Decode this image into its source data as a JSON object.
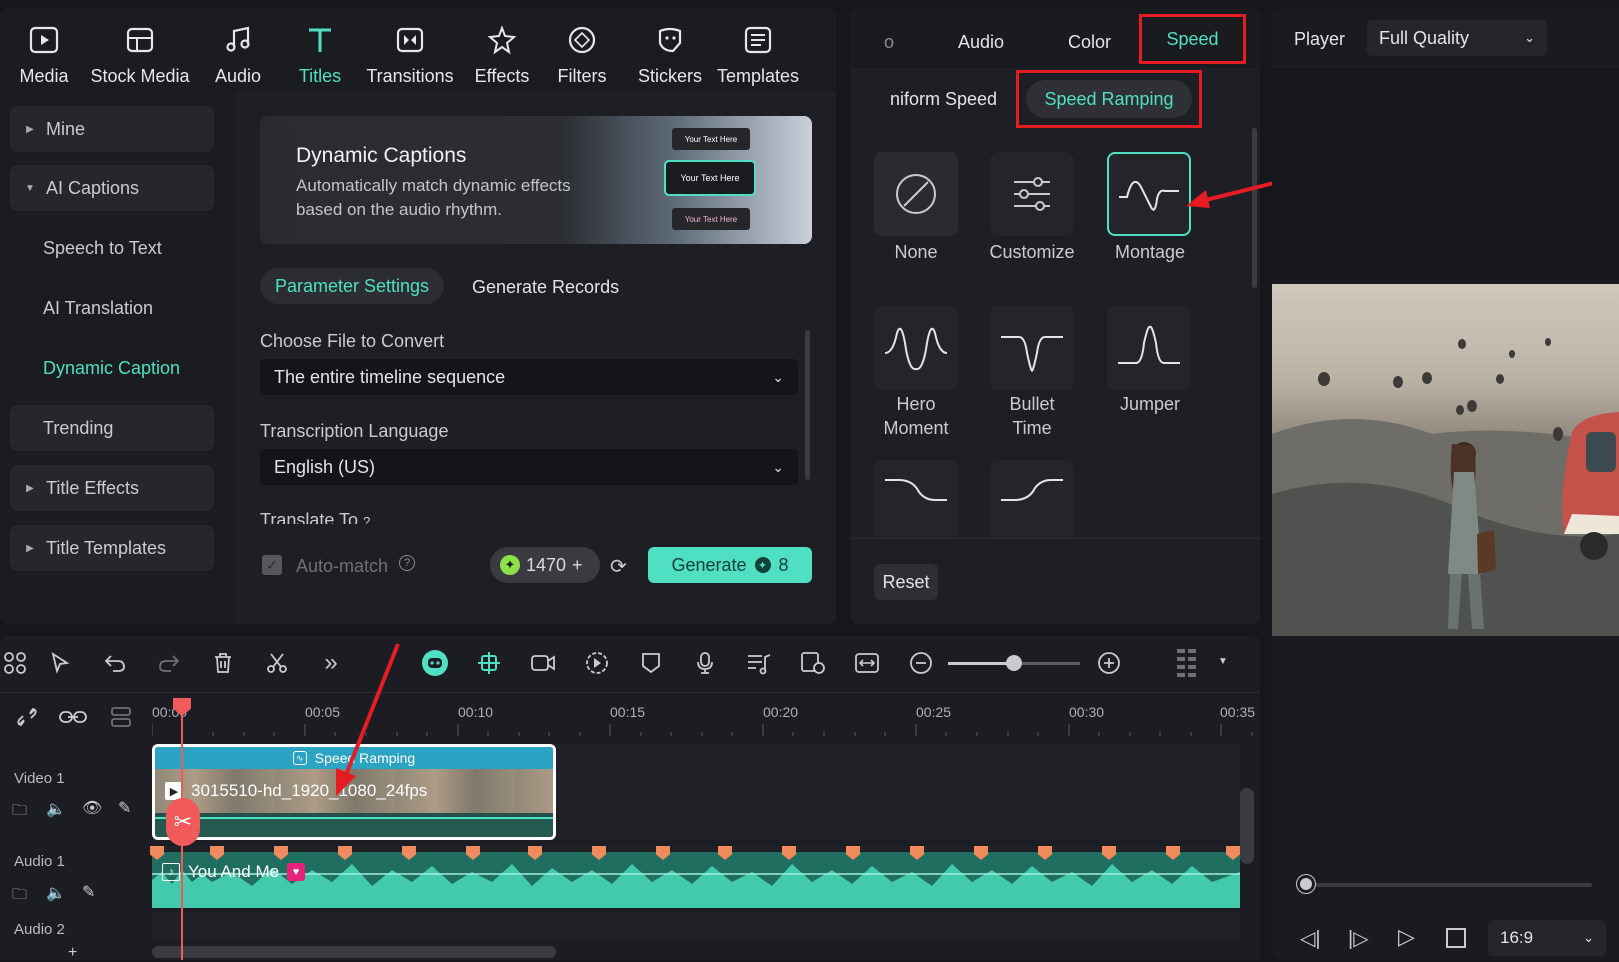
{
  "topnav": [
    {
      "label": "Media",
      "icon": "media-icon"
    },
    {
      "label": "Stock Media",
      "icon": "stock-media-icon"
    },
    {
      "label": "Audio",
      "icon": "music-note-icon"
    },
    {
      "label": "Titles",
      "icon": "titles-t-icon"
    },
    {
      "label": "Transitions",
      "icon": "transitions-icon"
    },
    {
      "label": "Effects",
      "icon": "effects-star-icon"
    },
    {
      "label": "Filters",
      "icon": "filters-icon"
    },
    {
      "label": "Stickers",
      "icon": "stickers-icon"
    },
    {
      "label": "Templates",
      "icon": "templates-icon"
    }
  ],
  "sidebar": {
    "items": [
      {
        "label": "Mine"
      },
      {
        "label": "AI Captions"
      },
      {
        "label": "Speech to Text"
      },
      {
        "label": "AI Translation"
      },
      {
        "label": "Dynamic Caption"
      },
      {
        "label": "Trending"
      },
      {
        "label": "Title Effects"
      },
      {
        "label": "Title Templates"
      }
    ]
  },
  "banner": {
    "title": "Dynamic Captions",
    "description": "Automatically match dynamic effects based on the audio rhythm.",
    "thumb_captions": [
      "Your Text Here",
      "Your Text Here",
      "Your Text Here"
    ]
  },
  "caption_tabs": [
    "Parameter Settings",
    "Generate Records"
  ],
  "form": {
    "file_label": "Choose File to Convert",
    "file_value": "The entire timeline sequence",
    "lang_label": "Transcription Language",
    "lang_value": "English (US)",
    "translate_label": "Translate To",
    "automatch_label": "Auto-match",
    "credits": "1470",
    "generate_label": "Generate",
    "generate_cost": "8"
  },
  "props": {
    "tabs": [
      "o",
      "Audio",
      "Color",
      "Speed"
    ],
    "subtabs": [
      "niform Speed",
      "Speed Ramping"
    ],
    "presets": [
      {
        "label": "None"
      },
      {
        "label": "Customize"
      },
      {
        "label": "Montage"
      },
      {
        "label": "Hero Moment"
      },
      {
        "label": "Bullet Time"
      },
      {
        "label": "Jumper"
      }
    ],
    "reset_label": "Reset"
  },
  "player": {
    "label": "Player",
    "quality": "Full Quality",
    "aspect": "16:9",
    "progress": 0.02
  },
  "timeline": {
    "ruler": [
      "00:00",
      "00:05",
      "00:10",
      "00:15",
      "00:20",
      "00:25",
      "00:30",
      "00:35"
    ],
    "tracks": [
      "Video 1",
      "Audio 1",
      "Audio 2"
    ],
    "video_clip": {
      "badge": "Speed Ramping",
      "name": "3015510-hd_1920_1080_24fps"
    },
    "audio_clip": {
      "name": "You And Me"
    },
    "zoom_level": 0.5
  },
  "colors": {
    "accent": "#4fe0c3",
    "highlight_box": "#e51c23",
    "playhead": "#f05a5a"
  }
}
